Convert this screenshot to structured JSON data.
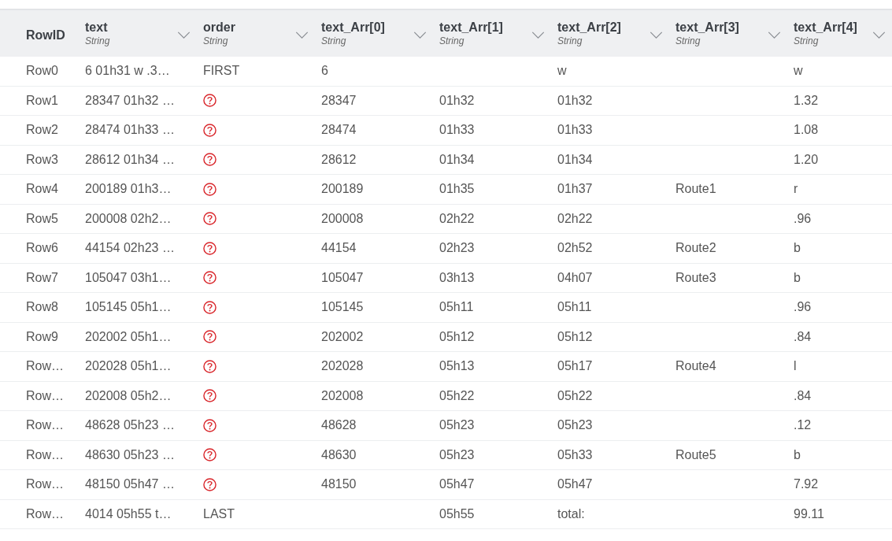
{
  "table": {
    "columns": [
      {
        "name": "RowID"
      },
      {
        "name": "text",
        "type": "String"
      },
      {
        "name": "order",
        "type": "String"
      },
      {
        "name": "text_Arr[0]",
        "type": "String"
      },
      {
        "name": "text_Arr[1]",
        "type": "String"
      },
      {
        "name": "text_Arr[2]",
        "type": "String"
      },
      {
        "name": "text_Arr[3]",
        "type": "String"
      },
      {
        "name": "text_Arr[4]",
        "type": "String"
      }
    ],
    "rows": [
      {
        "cells": [
          {
            "kind": "text",
            "text": "Row0"
          },
          {
            "kind": "text",
            "text": "6 01h31 w .3…"
          },
          {
            "kind": "text",
            "text": "FIRST"
          },
          {
            "kind": "text",
            "text": "6"
          },
          {
            "kind": "empty"
          },
          {
            "kind": "text",
            "text": "w"
          },
          {
            "kind": "empty"
          },
          {
            "kind": "text",
            "text": "w"
          }
        ]
      },
      {
        "cells": [
          {
            "kind": "text",
            "text": "Row1"
          },
          {
            "kind": "text",
            "text": "28347 01h32 …"
          },
          {
            "kind": "missing"
          },
          {
            "kind": "text",
            "text": "28347"
          },
          {
            "kind": "text",
            "text": "01h32"
          },
          {
            "kind": "text",
            "text": "01h32"
          },
          {
            "kind": "empty"
          },
          {
            "kind": "text",
            "text": "1.32"
          }
        ]
      },
      {
        "cells": [
          {
            "kind": "text",
            "text": "Row2"
          },
          {
            "kind": "text",
            "text": "28474 01h33 …"
          },
          {
            "kind": "missing"
          },
          {
            "kind": "text",
            "text": "28474"
          },
          {
            "kind": "text",
            "text": "01h33"
          },
          {
            "kind": "text",
            "text": "01h33"
          },
          {
            "kind": "empty"
          },
          {
            "kind": "text",
            "text": "1.08"
          }
        ]
      },
      {
        "cells": [
          {
            "kind": "text",
            "text": "Row3"
          },
          {
            "kind": "text",
            "text": "28612 01h34 …"
          },
          {
            "kind": "missing"
          },
          {
            "kind": "text",
            "text": "28612"
          },
          {
            "kind": "text",
            "text": "01h34"
          },
          {
            "kind": "text",
            "text": "01h34"
          },
          {
            "kind": "empty"
          },
          {
            "kind": "text",
            "text": "1.20"
          }
        ]
      },
      {
        "cells": [
          {
            "kind": "text",
            "text": "Row4"
          },
          {
            "kind": "text",
            "text": "200189 01h3…"
          },
          {
            "kind": "missing"
          },
          {
            "kind": "text",
            "text": "200189"
          },
          {
            "kind": "text",
            "text": "01h35"
          },
          {
            "kind": "text",
            "text": "01h37"
          },
          {
            "kind": "text",
            "text": "Route1"
          },
          {
            "kind": "text",
            "text": "r"
          }
        ]
      },
      {
        "cells": [
          {
            "kind": "text",
            "text": "Row5"
          },
          {
            "kind": "text",
            "text": "200008 02h2…"
          },
          {
            "kind": "missing"
          },
          {
            "kind": "text",
            "text": "200008"
          },
          {
            "kind": "text",
            "text": "02h22"
          },
          {
            "kind": "text",
            "text": "02h22"
          },
          {
            "kind": "empty"
          },
          {
            "kind": "text",
            "text": ".96"
          }
        ]
      },
      {
        "cells": [
          {
            "kind": "text",
            "text": "Row6"
          },
          {
            "kind": "text",
            "text": "44154 02h23 …"
          },
          {
            "kind": "missing"
          },
          {
            "kind": "text",
            "text": "44154"
          },
          {
            "kind": "text",
            "text": "02h23"
          },
          {
            "kind": "text",
            "text": "02h52"
          },
          {
            "kind": "text",
            "text": "Route2"
          },
          {
            "kind": "text",
            "text": "b"
          }
        ]
      },
      {
        "cells": [
          {
            "kind": "text",
            "text": "Row7"
          },
          {
            "kind": "text",
            "text": "105047 03h1…"
          },
          {
            "kind": "missing"
          },
          {
            "kind": "text",
            "text": "105047"
          },
          {
            "kind": "text",
            "text": "03h13"
          },
          {
            "kind": "text",
            "text": "04h07"
          },
          {
            "kind": "text",
            "text": "Route3"
          },
          {
            "kind": "text",
            "text": "b"
          }
        ]
      },
      {
        "cells": [
          {
            "kind": "text",
            "text": "Row8"
          },
          {
            "kind": "text",
            "text": "105145 05h1…"
          },
          {
            "kind": "missing"
          },
          {
            "kind": "text",
            "text": "105145"
          },
          {
            "kind": "text",
            "text": "05h11"
          },
          {
            "kind": "text",
            "text": "05h11"
          },
          {
            "kind": "empty"
          },
          {
            "kind": "text",
            "text": ".96"
          }
        ]
      },
      {
        "cells": [
          {
            "kind": "text",
            "text": "Row9"
          },
          {
            "kind": "text",
            "text": "202002 05h1…"
          },
          {
            "kind": "missing"
          },
          {
            "kind": "text",
            "text": "202002"
          },
          {
            "kind": "text",
            "text": "05h12"
          },
          {
            "kind": "text",
            "text": "05h12"
          },
          {
            "kind": "empty"
          },
          {
            "kind": "text",
            "text": ".84"
          }
        ]
      },
      {
        "cells": [
          {
            "kind": "text",
            "text": "Row…"
          },
          {
            "kind": "text",
            "text": "202028 05h1…"
          },
          {
            "kind": "missing"
          },
          {
            "kind": "text",
            "text": "202028"
          },
          {
            "kind": "text",
            "text": "05h13"
          },
          {
            "kind": "text",
            "text": "05h17"
          },
          {
            "kind": "text",
            "text": "Route4"
          },
          {
            "kind": "text",
            "text": "l"
          }
        ]
      },
      {
        "cells": [
          {
            "kind": "text",
            "text": "Row…"
          },
          {
            "kind": "text",
            "text": "202008 05h2…"
          },
          {
            "kind": "missing"
          },
          {
            "kind": "text",
            "text": "202008"
          },
          {
            "kind": "text",
            "text": "05h22"
          },
          {
            "kind": "text",
            "text": "05h22"
          },
          {
            "kind": "empty"
          },
          {
            "kind": "text",
            "text": ".84"
          }
        ]
      },
      {
        "cells": [
          {
            "kind": "text",
            "text": "Row…"
          },
          {
            "kind": "text",
            "text": "48628 05h23 …"
          },
          {
            "kind": "missing"
          },
          {
            "kind": "text",
            "text": "48628"
          },
          {
            "kind": "text",
            "text": "05h23"
          },
          {
            "kind": "text",
            "text": "05h23"
          },
          {
            "kind": "empty"
          },
          {
            "kind": "text",
            "text": ".12"
          }
        ]
      },
      {
        "cells": [
          {
            "kind": "text",
            "text": "Row…"
          },
          {
            "kind": "text",
            "text": "48630 05h23 …"
          },
          {
            "kind": "missing"
          },
          {
            "kind": "text",
            "text": "48630"
          },
          {
            "kind": "text",
            "text": "05h23"
          },
          {
            "kind": "text",
            "text": "05h33"
          },
          {
            "kind": "text",
            "text": "Route5"
          },
          {
            "kind": "text",
            "text": "b"
          }
        ]
      },
      {
        "cells": [
          {
            "kind": "text",
            "text": "Row…"
          },
          {
            "kind": "text",
            "text": "48150 05h47 …"
          },
          {
            "kind": "missing"
          },
          {
            "kind": "text",
            "text": "48150"
          },
          {
            "kind": "text",
            "text": "05h47"
          },
          {
            "kind": "text",
            "text": "05h47"
          },
          {
            "kind": "empty"
          },
          {
            "kind": "text",
            "text": "7.92"
          }
        ]
      },
      {
        "cells": [
          {
            "kind": "text",
            "text": "Row…"
          },
          {
            "kind": "text",
            "text": "4014 05h55 t…"
          },
          {
            "kind": "text",
            "text": "LAST"
          },
          {
            "kind": "empty"
          },
          {
            "kind": "text",
            "text": "05h55"
          },
          {
            "kind": "text",
            "text": "total:"
          },
          {
            "kind": "empty"
          },
          {
            "kind": "text",
            "text": "99.11"
          }
        ]
      }
    ]
  }
}
